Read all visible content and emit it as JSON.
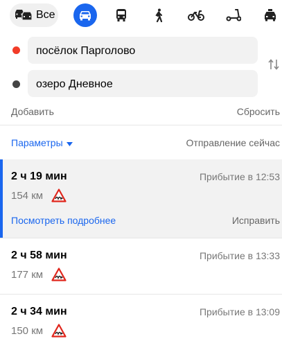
{
  "modes": {
    "all_label": "Все",
    "items": [
      "all",
      "car",
      "public-transport",
      "walk",
      "bike",
      "scooter",
      "taxi"
    ],
    "active": "car",
    "accent": "#1a66ee"
  },
  "route_form": {
    "from": "посёлок Парголово",
    "to": "озеро Дневное",
    "add_label": "Добавить",
    "reset_label": "Сбросить",
    "params_label": "Параметры",
    "departure_label": "Отправление сейчас"
  },
  "routes": [
    {
      "duration": "2 ч 19 мин",
      "arrival": "Прибытие в 12:53",
      "distance": "154 км",
      "warning": "road-bumps-icon",
      "details_label": "Посмотреть подробнее",
      "fix_label": "Исправить",
      "selected": true
    },
    {
      "duration": "2 ч 58 мин",
      "arrival": "Прибытие в 13:33",
      "distance": "177 км",
      "warning": "road-bumps-icon"
    },
    {
      "duration": "2 ч 34 мин",
      "arrival": "Прибытие в 13:09",
      "distance": "150 км",
      "warning": "road-bumps-icon"
    }
  ],
  "colors": {
    "start_marker": "#f23c28",
    "end_marker": "#444444",
    "warning": "#e0261c"
  }
}
